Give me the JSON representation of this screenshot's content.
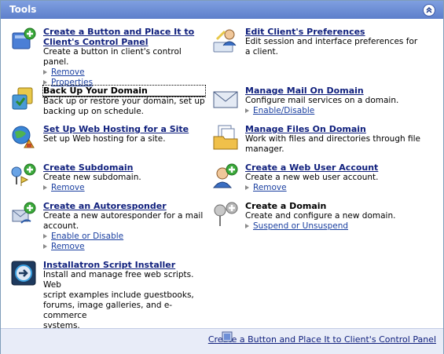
{
  "header": {
    "title": "Tools"
  },
  "left": [
    {
      "title": "Create a Button and Place It to Client's Control Panel",
      "title_line1": "Create a Button and Place It to",
      "title_line2": "Client's Control Panel",
      "desc": "Create a button in client's control panel.",
      "links": [
        "Remove",
        "Properties"
      ],
      "icon": "create-button-icon"
    },
    {
      "title": "Back Up Your Domain",
      "desc_line1": "Back up or restore your domain, set up",
      "desc_line2": "backing up on schedule.",
      "icon": "backup-icon"
    },
    {
      "title": "Set Up Web Hosting for a Site",
      "desc": "Set up Web hosting for a site.",
      "icon": "web-hosting-icon"
    },
    {
      "title": "Create Subdomain",
      "desc": "Create new subdomain.",
      "links": [
        "Remove"
      ],
      "icon": "subdomain-icon"
    },
    {
      "title": "Create an Autoresponder",
      "desc_line1": "Create a new autoresponder for a mail",
      "desc_line2": "account.",
      "links": [
        "Enable or Disable",
        "Remove"
      ],
      "icon": "autoresponder-icon"
    },
    {
      "title": "Installatron Script Installer",
      "desc_line1": "Install and manage free web scripts. Web",
      "desc_line2": "script examples include guestbooks,",
      "desc_line3": "forums, image galleries, and e-commerce",
      "desc_line4": "systems.",
      "icon": "installatron-icon"
    }
  ],
  "right": [
    {
      "title": "Edit Client's Preferences",
      "desc_line1": "Edit session and interface preferences for",
      "desc_line2": "a client.",
      "icon": "client-preferences-icon"
    },
    {
      "title": "Manage Mail On Domain",
      "desc": "Configure mail services on a domain.",
      "links": [
        "Enable/Disable"
      ],
      "icon": "mail-icon"
    },
    {
      "title": "Manage Files On Domain",
      "desc_line1": "Work with files and directories through file",
      "desc_line2": "manager.",
      "icon": "files-icon"
    },
    {
      "title": "Create a Web User Account",
      "desc": "Create a new web user account.",
      "links": [
        "Remove"
      ],
      "icon": "web-user-icon"
    },
    {
      "title": "Create a Domain",
      "desc": "Create and configure a new domain.",
      "links": [
        "Suspend or Unsuspend"
      ],
      "icon": "domain-icon"
    }
  ],
  "footer": {
    "link": "Create a Button and Place It to Client's Control Panel"
  },
  "colors": {
    "header": "#6e8fd6",
    "link": "#10207d",
    "footer": "#e8ecf8"
  }
}
